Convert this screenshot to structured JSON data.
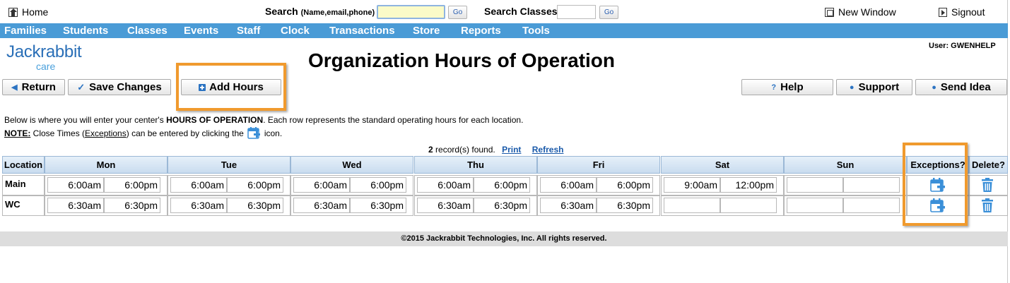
{
  "topbar": {
    "home_label": "Home",
    "search_label": "Search",
    "search_hint": "(Name,email,phone)",
    "search_value": "",
    "go_label": "Go",
    "classes_label": "Search Classes:",
    "classes_value": "",
    "new_window_label": "New Window",
    "signout_label": "Signout"
  },
  "nav": [
    "Families",
    "Students",
    "Classes",
    "Events",
    "Staff",
    "Clock",
    "Transactions",
    "Store",
    "Reports",
    "Tools"
  ],
  "header": {
    "logo_main": "Jackrabbit",
    "logo_sub": "care",
    "title": "Organization Hours of Operation",
    "user": "User: GWENHELP"
  },
  "toolbar": {
    "return_label": "Return",
    "save_label": "Save Changes",
    "add_hours_label": "Add Hours",
    "help_label": "Help",
    "support_label": "Support",
    "send_idea_label": "Send Idea"
  },
  "description": {
    "line1_pre": "Below is where you will enter your center's ",
    "line1_bold": "HOURS OF OPERATION",
    "line1_post": ". Each row represents the standard operating hours for each location.",
    "note_label": "NOTE:",
    "note_pre": " Close Times (",
    "note_exceptions": "Exceptions",
    "note_mid": ") can be entered by clicking the",
    "note_post": "icon."
  },
  "records": {
    "count": "2",
    "suffix": " record(s) found.",
    "print_label": "Print",
    "refresh_label": "Refresh"
  },
  "table": {
    "headers": {
      "location": "Location",
      "days": [
        "Mon",
        "Tue",
        "Wed",
        "Thu",
        "Fri",
        "Sat",
        "Sun"
      ],
      "exceptions": "Exceptions?",
      "delete": "Delete?"
    },
    "rows": [
      {
        "location": "Main",
        "hours": [
          [
            "6:00am",
            "6:00pm"
          ],
          [
            "6:00am",
            "6:00pm"
          ],
          [
            "6:00am",
            "6:00pm"
          ],
          [
            "6:00am",
            "6:00pm"
          ],
          [
            "6:00am",
            "6:00pm"
          ],
          [
            "9:00am",
            "12:00pm"
          ],
          [
            "",
            ""
          ]
        ]
      },
      {
        "location": "WC",
        "hours": [
          [
            "6:30am",
            "6:30pm"
          ],
          [
            "6:30am",
            "6:30pm"
          ],
          [
            "6:30am",
            "6:30pm"
          ],
          [
            "6:30am",
            "6:30pm"
          ],
          [
            "6:30am",
            "6:30pm"
          ],
          [
            "",
            ""
          ],
          [
            "",
            ""
          ]
        ]
      }
    ]
  },
  "footer": {
    "text": "©2015  Jackrabbit Technologies, Inc.    All rights reserved."
  },
  "colors": {
    "nav_bg": "#4a9bd6",
    "highlight": "#f09a2e",
    "link": "#1a5aaa",
    "icon_blue": "#2b73c2"
  }
}
